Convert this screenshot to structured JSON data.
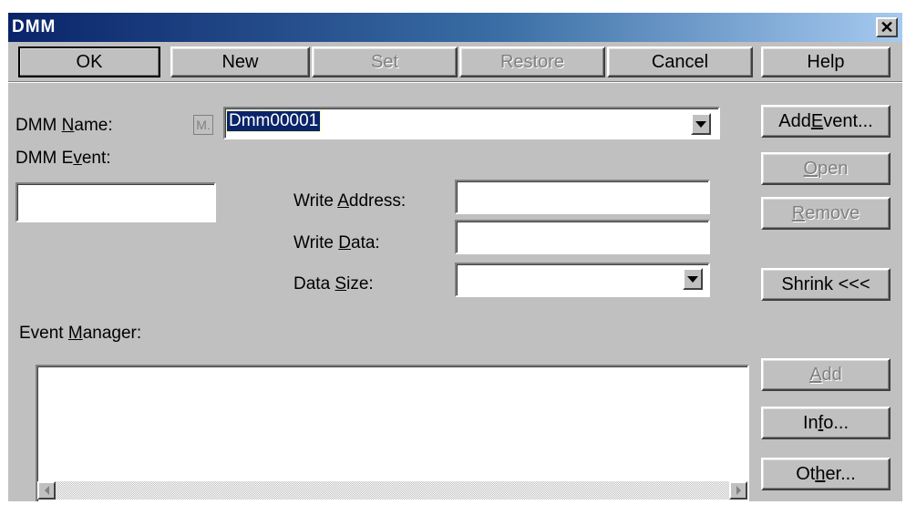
{
  "window": {
    "title": "DMM"
  },
  "toolbar": {
    "ok": "OK",
    "new": "New",
    "set": "Set",
    "restore": "Restore",
    "cancel": "Cancel",
    "help": "Help"
  },
  "form": {
    "dmm_name_label": "DMM Name:",
    "m_button": "M.",
    "dmm_name_value": "Dmm00001",
    "dmm_event_label": "DMM Event:",
    "write_address_label": "Write Address:",
    "write_address_value": "",
    "write_data_label": "Write Data:",
    "write_data_value": "",
    "data_size_label": "Data Size:",
    "data_size_value": "",
    "event_manager_label": "Event Manager:"
  },
  "side_buttons": {
    "add_event": "Add Event...",
    "open": "Open",
    "remove": "Remove",
    "shrink": "Shrink <<<",
    "add": "Add",
    "info": "Info...",
    "other": "Other..."
  },
  "icons": {
    "close": "close-icon",
    "dropdown": "chevron-down-icon",
    "scroll_left": "scroll-left-icon",
    "scroll_right": "scroll-right-icon"
  },
  "colors": {
    "face": "#c0c0c0",
    "title_start": "#0a246a",
    "title_end": "#a6caf0",
    "selection": "#0a246a"
  }
}
